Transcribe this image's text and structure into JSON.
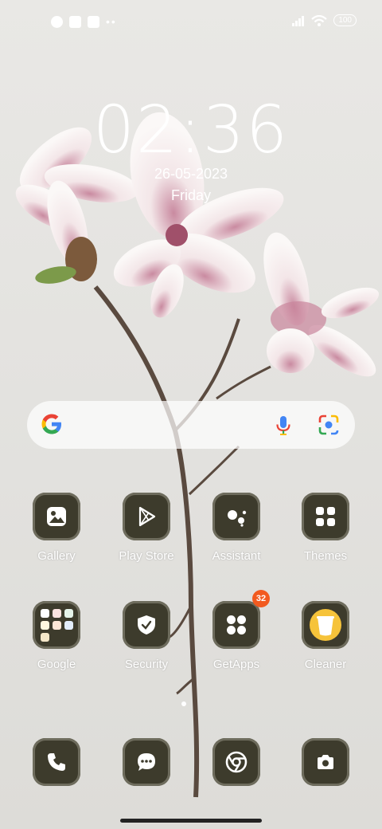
{
  "status_bar": {
    "battery": "100"
  },
  "lockscreen": {
    "time": "02:36",
    "date": "26-05-2023",
    "day": "Friday"
  },
  "search": {
    "icons": [
      "google-g-icon",
      "microphone-icon",
      "google-lens-icon"
    ]
  },
  "apps_row1": [
    {
      "label": "Gallery"
    },
    {
      "label": "Play Store"
    },
    {
      "label": "Assistant"
    },
    {
      "label": "Themes"
    }
  ],
  "apps_row2": [
    {
      "label": "Google"
    },
    {
      "label": "Security"
    },
    {
      "label": "GetApps",
      "badge": "32"
    },
    {
      "label": "Cleaner"
    }
  ],
  "dock": [
    {
      "icon": "phone-icon"
    },
    {
      "icon": "messages-icon"
    },
    {
      "icon": "chrome-icon"
    },
    {
      "icon": "camera-icon"
    }
  ],
  "colors": {
    "tile": "#3d3b2c",
    "badge": "#f25a1f",
    "cleaner_yellow": "#f6c33a"
  }
}
